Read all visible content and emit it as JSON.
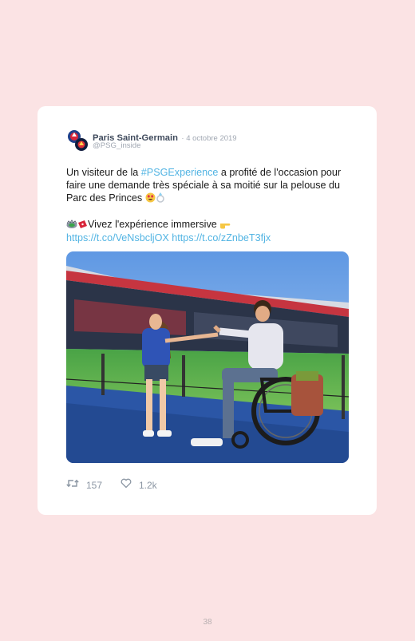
{
  "tweet": {
    "author_name": "Paris Saint-Germain",
    "date": "· 4 octobre 2019",
    "handle": "@PSG_inside",
    "text_part1": "Un visiteur de la ",
    "hashtag": "#PSGExperience",
    "text_part2": " a profité de l'occasion pour faire une demande très spéciale à sa moitié sur la pelouse du Parc des Princes ",
    "emojis_line1": [
      "smiling-face-with-heart-eyes",
      "ring"
    ],
    "cta_text": "Vivez l'expérience immersive",
    "emojis_line2_before": [
      "stadium",
      "ticket"
    ],
    "emojis_line2_after": [
      "backhand-index-pointing-right"
    ],
    "link1": "https://t.co/VeNsbcljOX",
    "link2": "https://t.co/zZnbeT3fjx",
    "image_description_icon": "photo",
    "retweet_count": "157",
    "like_count": "1.2k"
  },
  "page": {
    "number": "38"
  },
  "colors": {
    "background": "#fbe3e4",
    "card": "#ffffff",
    "link": "#52b4e3",
    "muted": "#a0a7b2"
  },
  "icons": {
    "retweet": "retweet-icon",
    "like": "heart-icon",
    "avatar": "psg-logo-avatar"
  }
}
